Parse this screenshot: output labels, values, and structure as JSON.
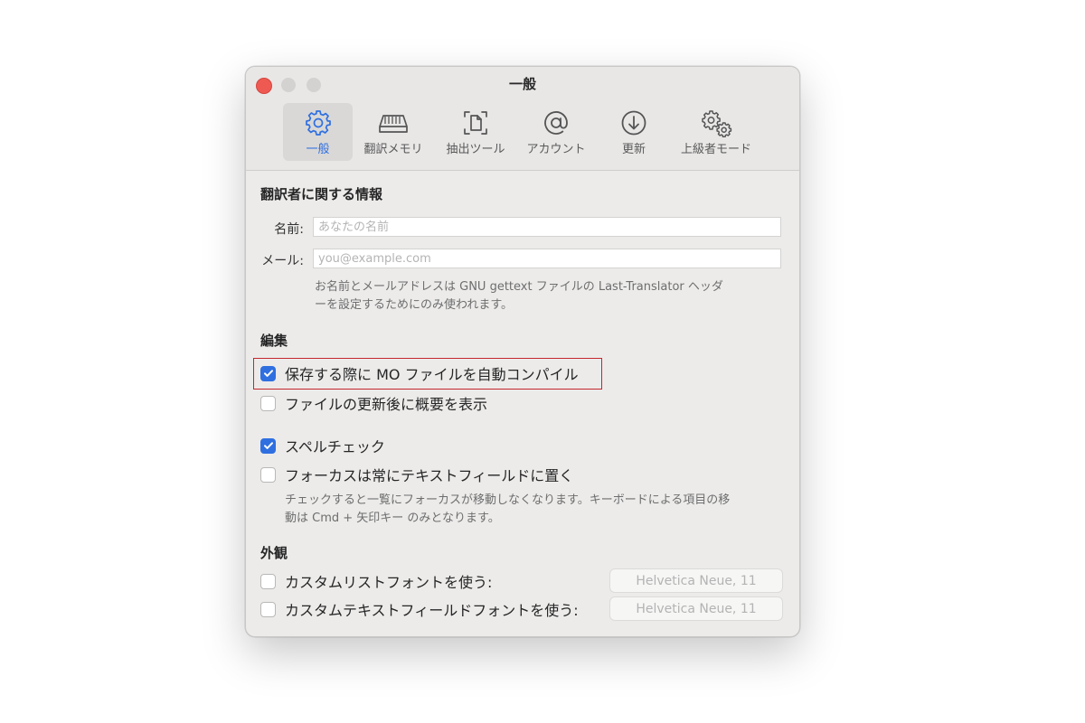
{
  "window": {
    "title": "一般"
  },
  "toolbar": {
    "tabs": [
      {
        "label": "一般",
        "icon": "gear-icon",
        "active": true
      },
      {
        "label": "翻訳メモリ",
        "icon": "drive-icon",
        "active": false
      },
      {
        "label": "抽出ツール",
        "icon": "document-scan-icon",
        "active": false
      },
      {
        "label": "アカウント",
        "icon": "at-icon",
        "active": false
      },
      {
        "label": "更新",
        "icon": "download-circle-icon",
        "active": false
      },
      {
        "label": "上級者モード",
        "icon": "gears-icon",
        "active": false
      }
    ]
  },
  "translator": {
    "heading": "翻訳者に関する情報",
    "name_label": "名前:",
    "name_placeholder": "あなたの名前",
    "mail_label": "メール:",
    "mail_placeholder": "you@example.com",
    "hint_line1": "お名前とメールアドレスは GNU gettext ファイルの Last-Translator ヘッダ",
    "hint_line2": "ーを設定するためにのみ使われます。"
  },
  "editing": {
    "heading": "編集",
    "options": [
      {
        "label": "保存する際に MO ファイルを自動コンパイル",
        "checked": true
      },
      {
        "label": "ファイルの更新後に概要を表示",
        "checked": false
      },
      {
        "label": "スペルチェック",
        "checked": true
      },
      {
        "label": "フォーカスは常にテキストフィールドに置く",
        "checked": false
      }
    ],
    "hint_line1": "チェックすると一覧にフォーカスが移動しなくなります。キーボードによる項目の移",
    "hint_line2": "動は Cmd + 矢印キー のみとなります。"
  },
  "appearance": {
    "heading": "外観",
    "options": [
      {
        "label": "カスタムリストフォントを使う:",
        "checked": false,
        "font": "Helvetica Neue, 11"
      },
      {
        "label": "カスタムテキストフィールドフォントを使う:",
        "checked": false,
        "font": "Helvetica Neue, 11"
      }
    ]
  },
  "colors": {
    "accent": "#2f6fe0",
    "highlight": "#c4262e",
    "close": "#ee5a52"
  }
}
